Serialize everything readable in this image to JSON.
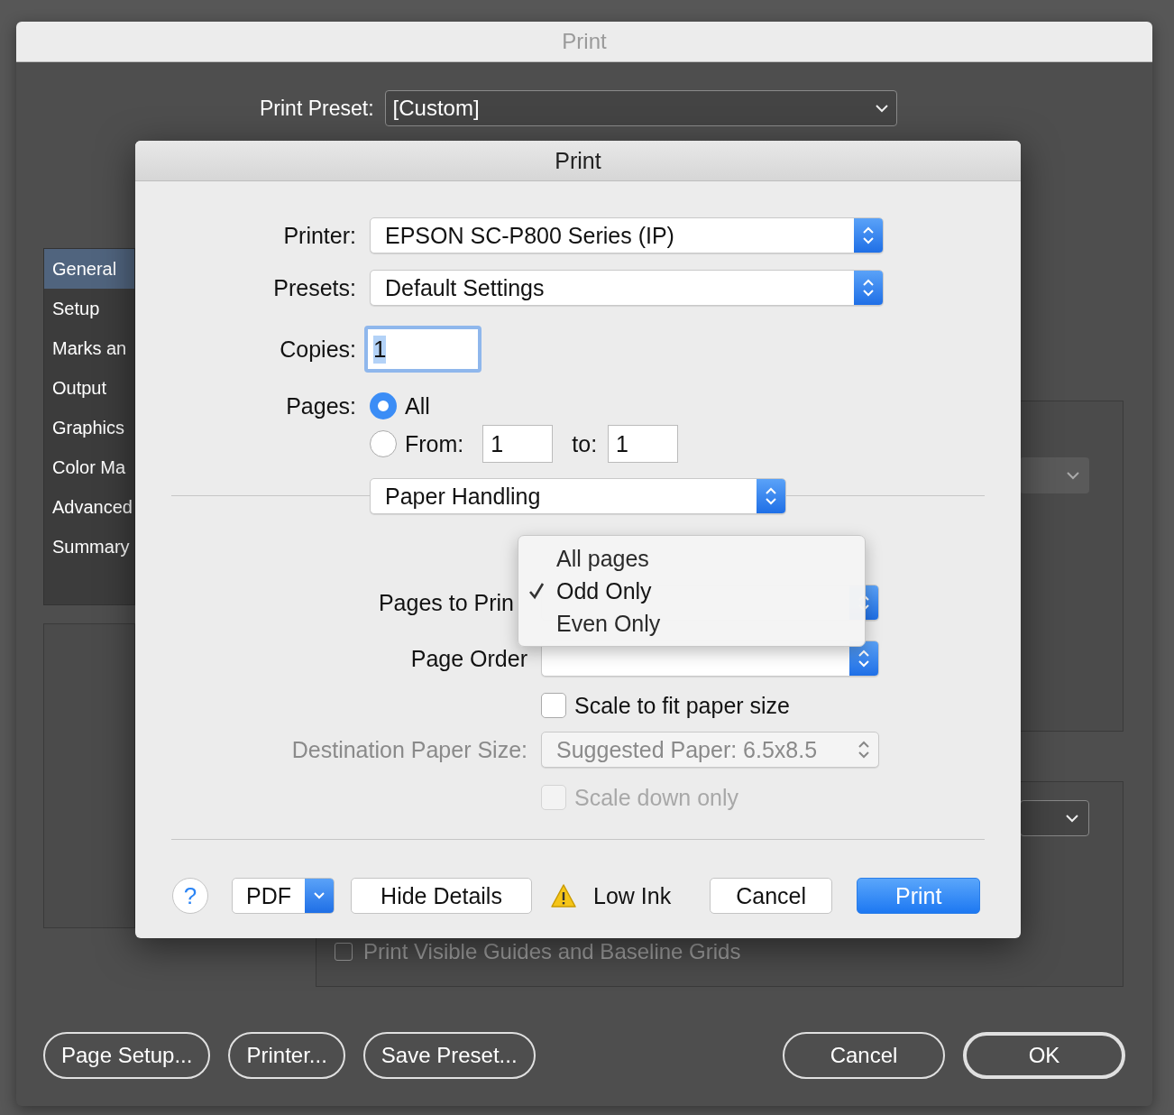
{
  "back_window": {
    "title": "Print",
    "print_preset": {
      "label": "Print Preset:",
      "value": "[Custom]"
    },
    "sidebar": {
      "items": [
        {
          "label": "General",
          "selected": true
        },
        {
          "label": "Setup",
          "selected": false
        },
        {
          "label": "Marks an",
          "selected": false
        },
        {
          "label": "Output",
          "selected": false
        },
        {
          "label": "Graphics",
          "selected": false
        },
        {
          "label": "Color Ma",
          "selected": false
        },
        {
          "label": "Advanced",
          "selected": false
        },
        {
          "label": "Summary",
          "selected": false
        }
      ]
    },
    "option": {
      "label": "Print Visible Guides and Baseline Grids",
      "checked": false
    },
    "buttons": [
      {
        "label": "Page Setup...",
        "default": false
      },
      {
        "label": "Printer...",
        "default": false
      },
      {
        "label": "Save Preset...",
        "default": false
      },
      {
        "label": "Cancel",
        "default": false
      },
      {
        "label": "OK",
        "default": true
      }
    ]
  },
  "print_sheet": {
    "title": "Print",
    "printer": {
      "label": "Printer:",
      "value": "EPSON SC-P800 Series (IP)"
    },
    "presets": {
      "label": "Presets:",
      "value": "Default Settings"
    },
    "copies": {
      "label": "Copies:",
      "value": "1"
    },
    "pages": {
      "label": "Pages:",
      "options": [
        {
          "label": "All",
          "selected": true
        },
        {
          "label": "From:",
          "selected": false
        }
      ],
      "from": "1",
      "to_label": "to:",
      "to": "1"
    },
    "section": {
      "value": "Paper Handling"
    },
    "pages_to_print": {
      "label": "Pages to Prin"
    },
    "page_order": {
      "label": "Page Order"
    },
    "scale_to_fit": {
      "label": "Scale to fit paper size",
      "checked": false,
      "disabled": false
    },
    "destination_paper_size": {
      "label": "Destination Paper Size:",
      "value": "Suggested Paper: 6.5x8.5",
      "disabled": true
    },
    "scale_down_only": {
      "label": "Scale down only",
      "checked": false,
      "disabled": true
    },
    "help": "?",
    "pdf": "PDF",
    "hide_details": "Hide Details",
    "status": "Low Ink",
    "buttons": [
      {
        "label": "Cancel",
        "default": false
      },
      {
        "label": "Print",
        "default": true
      }
    ]
  },
  "menu": {
    "items": [
      {
        "label": "All pages",
        "selected": false
      },
      {
        "label": "Odd Only",
        "selected": true
      },
      {
        "label": "Even Only",
        "selected": false
      }
    ]
  }
}
